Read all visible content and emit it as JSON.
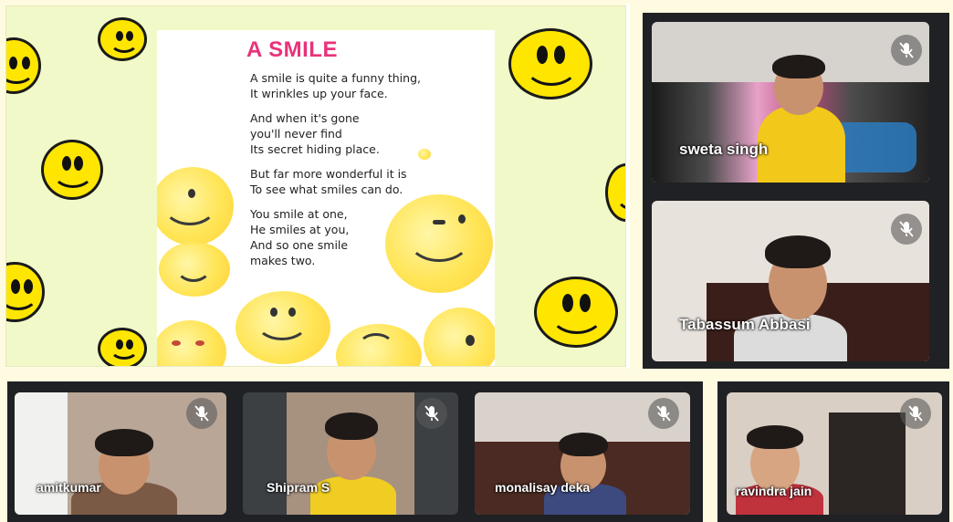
{
  "slide": {
    "title": "A SMILE",
    "stanzas": [
      [
        "A smile is quite a funny thing,",
        "It wrinkles up your face."
      ],
      [
        "And when it's gone",
        "you'll never find",
        "Its secret hiding place."
      ],
      [
        "But far more wonderful it is",
        "To see what smiles can do."
      ],
      [
        "You smile at one,",
        "He smiles at you,",
        "And so one smile",
        "makes two."
      ]
    ]
  },
  "participants": [
    {
      "name": "sweta singh",
      "muted": true,
      "icon": "mic-off-icon"
    },
    {
      "name": "Tabassum Abbasi",
      "muted": true,
      "icon": "mic-off-icon"
    },
    {
      "name": "amitkumar",
      "muted": true,
      "icon": "mic-off-icon"
    },
    {
      "name": "Shipram S",
      "muted": true,
      "icon": "mic-off-icon"
    },
    {
      "name": "monalisay deka",
      "muted": true,
      "icon": "mic-off-icon"
    },
    {
      "name": "ravindra jain",
      "muted": true,
      "icon": "mic-off-icon"
    }
  ],
  "colors": {
    "slide_title": "#e8337a",
    "slide_background": "#f2f9c9",
    "smiley_yellow": "#ffe600",
    "tile_background": "#3c4043"
  }
}
